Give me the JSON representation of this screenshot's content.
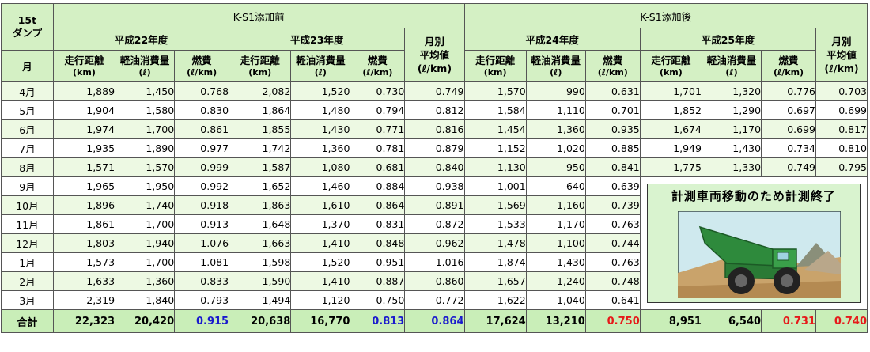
{
  "corner": {
    "line1": "15t",
    "line2": "ダンプ",
    "month_label": "月"
  },
  "groups": {
    "before": "K-S1添加前",
    "after": "K-S1添加後"
  },
  "years": [
    "平成22年度",
    "平成23年度",
    "平成24年度",
    "平成25年度"
  ],
  "subheads": {
    "distance": "走行距離",
    "distance_unit": "(km)",
    "fuel": "軽油消費量",
    "fuel_unit": "(ℓ)",
    "eff": "燃費",
    "eff_unit": "(ℓ/km)"
  },
  "avg_head": {
    "line1": "月別",
    "line2": "平均値",
    "line3": "(ℓ/km)"
  },
  "rows": [
    {
      "month": "4月",
      "h22": [
        "1,889",
        "1,450",
        "0.768"
      ],
      "h23": [
        "2,082",
        "1,520",
        "0.730"
      ],
      "avg1": "0.749",
      "h24": [
        "1,570",
        "990",
        "0.631"
      ],
      "h25": [
        "1,701",
        "1,320",
        "0.776"
      ],
      "avg2": "0.703"
    },
    {
      "month": "5月",
      "h22": [
        "1,904",
        "1,580",
        "0.830"
      ],
      "h23": [
        "1,864",
        "1,480",
        "0.794"
      ],
      "avg1": "0.812",
      "h24": [
        "1,584",
        "1,110",
        "0.701"
      ],
      "h25": [
        "1,852",
        "1,290",
        "0.697"
      ],
      "avg2": "0.699"
    },
    {
      "month": "6月",
      "h22": [
        "1,974",
        "1,700",
        "0.861"
      ],
      "h23": [
        "1,855",
        "1,430",
        "0.771"
      ],
      "avg1": "0.816",
      "h24": [
        "1,454",
        "1,360",
        "0.935"
      ],
      "h25": [
        "1,674",
        "1,170",
        "0.699"
      ],
      "avg2": "0.817"
    },
    {
      "month": "7月",
      "h22": [
        "1,935",
        "1,890",
        "0.977"
      ],
      "h23": [
        "1,742",
        "1,360",
        "0.781"
      ],
      "avg1": "0.879",
      "h24": [
        "1,152",
        "1,020",
        "0.885"
      ],
      "h25": [
        "1,949",
        "1,430",
        "0.734"
      ],
      "avg2": "0.810"
    },
    {
      "month": "8月",
      "h22": [
        "1,571",
        "1,570",
        "0.999"
      ],
      "h23": [
        "1,587",
        "1,080",
        "0.681"
      ],
      "avg1": "0.840",
      "h24": [
        "1,130",
        "950",
        "0.841"
      ],
      "h25": [
        "1,775",
        "1,330",
        "0.749"
      ],
      "avg2": "0.795"
    },
    {
      "month": "9月",
      "h22": [
        "1,965",
        "1,950",
        "0.992"
      ],
      "h23": [
        "1,652",
        "1,460",
        "0.884"
      ],
      "avg1": "0.938",
      "h24": [
        "1,001",
        "640",
        "0.639"
      ]
    },
    {
      "month": "10月",
      "h22": [
        "1,896",
        "1,740",
        "0.918"
      ],
      "h23": [
        "1,863",
        "1,610",
        "0.864"
      ],
      "avg1": "0.891",
      "h24": [
        "1,569",
        "1,160",
        "0.739"
      ]
    },
    {
      "month": "11月",
      "h22": [
        "1,861",
        "1,700",
        "0.913"
      ],
      "h23": [
        "1,648",
        "1,370",
        "0.831"
      ],
      "avg1": "0.872",
      "h24": [
        "1,533",
        "1,170",
        "0.763"
      ]
    },
    {
      "month": "12月",
      "h22": [
        "1,803",
        "1,940",
        "1.076"
      ],
      "h23": [
        "1,663",
        "1,410",
        "0.848"
      ],
      "avg1": "0.962",
      "h24": [
        "1,478",
        "1,100",
        "0.744"
      ]
    },
    {
      "month": "1月",
      "h22": [
        "1,573",
        "1,700",
        "1.081"
      ],
      "h23": [
        "1,598",
        "1,520",
        "0.951"
      ],
      "avg1": "1.016",
      "h24": [
        "1,874",
        "1,430",
        "0.763"
      ]
    },
    {
      "month": "2月",
      "h22": [
        "1,633",
        "1,360",
        "0.833"
      ],
      "h23": [
        "1,590",
        "1,410",
        "0.887"
      ],
      "avg1": "0.860",
      "h24": [
        "1,657",
        "1,240",
        "0.748"
      ]
    },
    {
      "month": "3月",
      "h22": [
        "2,319",
        "1,840",
        "0.793"
      ],
      "h23": [
        "1,494",
        "1,120",
        "0.750"
      ],
      "avg1": "0.772",
      "h24": [
        "1,622",
        "1,040",
        "0.641"
      ]
    }
  ],
  "total": {
    "label": "合計",
    "h22": [
      "22,323",
      "20,420",
      "0.915"
    ],
    "h23": [
      "20,638",
      "16,770",
      "0.813"
    ],
    "avg1": "0.864",
    "h24": [
      "17,624",
      "13,210",
      "0.750"
    ],
    "h25": [
      "8,951",
      "6,540",
      "0.731"
    ],
    "avg2": "0.740"
  },
  "notice": "計測車両移動のため計測終了",
  "colors": {
    "header_bg": "#d4f0c4",
    "alt_row": "#edf9e3",
    "total_bg": "#c9eeb8",
    "blue": "#1a1acd",
    "red": "#e61a1a"
  }
}
